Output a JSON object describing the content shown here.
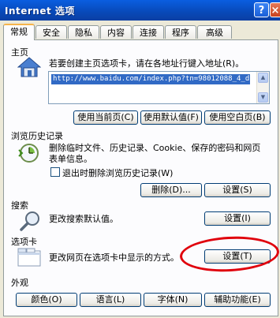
{
  "window": {
    "title": "Internet 选项",
    "help_label": "?",
    "close_label": "×"
  },
  "tabs": [
    {
      "label": "常规"
    },
    {
      "label": "安全"
    },
    {
      "label": "隐私"
    },
    {
      "label": "内容"
    },
    {
      "label": "连接"
    },
    {
      "label": "程序"
    },
    {
      "label": "高级"
    }
  ],
  "homepage": {
    "title": "主页",
    "description": "若要创建主页选项卡，请在各地址行键入地址(R)。",
    "address": "http://www.baidu.com/index.php?tn=98012088_4_d",
    "use_current": "使用当前页(C)",
    "use_default": "使用默认值(F)",
    "use_blank": "使用空白页(B)"
  },
  "history": {
    "title": "浏览历史记录",
    "description": "删除临时文件、历史记录、Cookie、保存的密码和网页表单信息。",
    "delete_on_exit": "退出时删除浏览历史记录(W)",
    "delete_on_exit_checked": false,
    "delete_button": "删除(D)...",
    "settings_button": "设置(S)"
  },
  "search": {
    "title": "搜索",
    "description": "更改搜索默认值。",
    "settings_button": "设置(I)"
  },
  "tabs_section": {
    "title": "选项卡",
    "description": "更改网页在选项卡中显示的方式。",
    "settings_button": "设置(T)"
  },
  "appearance": {
    "title": "外观",
    "colors": "颜色(O)",
    "languages": "语言(L)",
    "fonts": "字体(N)",
    "accessibility": "辅助功能(E)"
  },
  "colors": {
    "titlebar": "#0a5ee0",
    "tab_highlight": "#f6b44a",
    "annotation": "#e0000c"
  }
}
